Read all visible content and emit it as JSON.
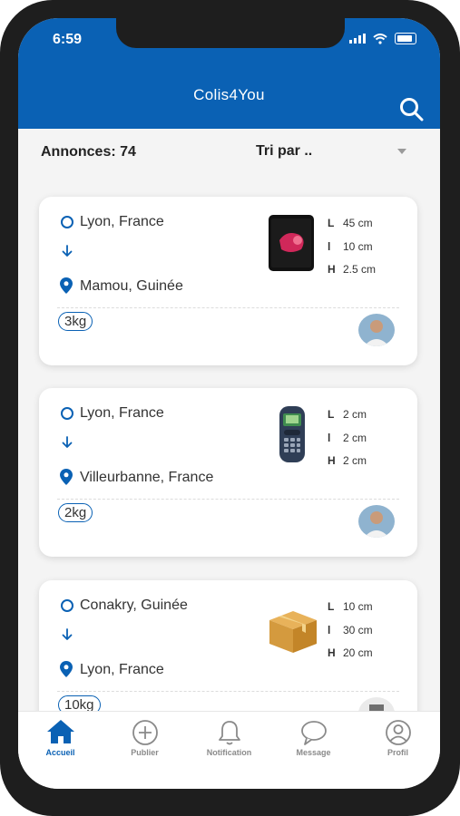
{
  "status_bar": {
    "time": "6:59"
  },
  "header": {
    "title": "Colis4You"
  },
  "toolbar": {
    "count_label": "Annonces: 74",
    "sort_label": "Tri par .."
  },
  "listings": [
    {
      "origin": "Lyon, France",
      "destination": "Mamou, Guinée",
      "weight": "3kg",
      "item_icon": "phone-icon",
      "dimensions": [
        {
          "key": "L",
          "value": "45 cm"
        },
        {
          "key": "l",
          "value": "10 cm"
        },
        {
          "key": "H",
          "value": "2.5 cm"
        }
      ]
    },
    {
      "origin": "Lyon, France",
      "destination": "Villeurbanne, France",
      "weight": "2kg",
      "item_icon": "mobile-phone-icon",
      "dimensions": [
        {
          "key": "L",
          "value": "2 cm"
        },
        {
          "key": "l",
          "value": "2 cm"
        },
        {
          "key": "H",
          "value": "2 cm"
        }
      ]
    },
    {
      "origin": "Conakry, Guinée",
      "destination": "Lyon, France",
      "weight": "10kg",
      "item_icon": "box-icon",
      "dimensions": [
        {
          "key": "L",
          "value": "10 cm"
        },
        {
          "key": "l",
          "value": "30 cm"
        },
        {
          "key": "H",
          "value": "20 cm"
        }
      ]
    }
  ],
  "tabs": [
    {
      "label": "Accueil",
      "icon": "home-icon",
      "active": true
    },
    {
      "label": "Publier",
      "icon": "add-circle-icon",
      "active": false
    },
    {
      "label": "Notification",
      "icon": "bell-icon",
      "active": false
    },
    {
      "label": "Message",
      "icon": "chat-icon",
      "active": false
    },
    {
      "label": "Profil",
      "icon": "profile-icon",
      "active": false
    }
  ],
  "colors": {
    "primary": "#0a61b4",
    "background": "#f4f4f4",
    "card": "#ffffff"
  }
}
